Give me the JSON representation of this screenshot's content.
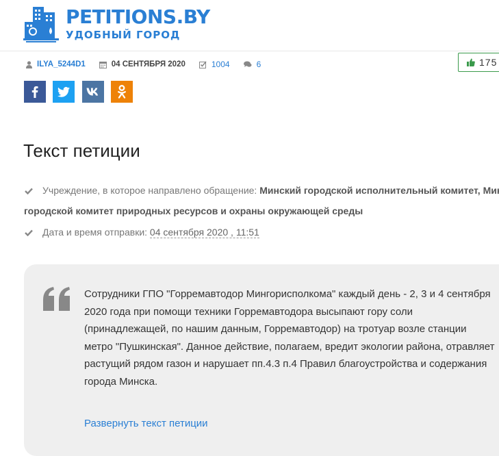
{
  "brand": {
    "name": "PETITIONS.BY",
    "tagline": "УДОБНЫЙ ГОРОД"
  },
  "meta": {
    "author": "ILYA_5244D1",
    "date": "04 СЕНТЯБРЯ 2020",
    "signatures": "1004",
    "comments": "6"
  },
  "likes": {
    "count": "175"
  },
  "share": {
    "icons": [
      "facebook-icon",
      "twitter-icon",
      "vk-icon",
      "odnoklassniki-icon"
    ]
  },
  "title": "Текст петиции",
  "details": {
    "institution_label": "Учреждение, в которое направлено обращение:",
    "institution_value_line1": "Минский городской исполнительный комитет, Минс",
    "institution_value_line2": "городской комитет природных ресурсов и охраны окружающей среды",
    "sent_label": "Дата и время отправки:",
    "sent_value": "04 сентября 2020 , 11:51"
  },
  "petition": {
    "text": "Сотрудники ГПО \"Горремавтодор Мингорисполкома\" каждый день - 2, 3 и 4 сентября 2020 года при помощи техники Горремавтодора высыпают гору соли (принадлежащей, по нашим данным, Горремавтодор) на тротуар возле станции метро \"Пушкинская\". Данное действие, полагаем, вредит экологии района, отравляет растущий рядом газон и нарушает пп.4.3 п.4 Правил благоустройства и содержания города Минска.",
    "expand_label": "Развернуть текст петиции"
  },
  "colors": {
    "accent": "#2a7fd4",
    "like_border": "#3a9a4b",
    "facebook": "#3b5998",
    "twitter": "#1da1f2",
    "vk": "#4c75a3",
    "ok": "#ee8208"
  }
}
